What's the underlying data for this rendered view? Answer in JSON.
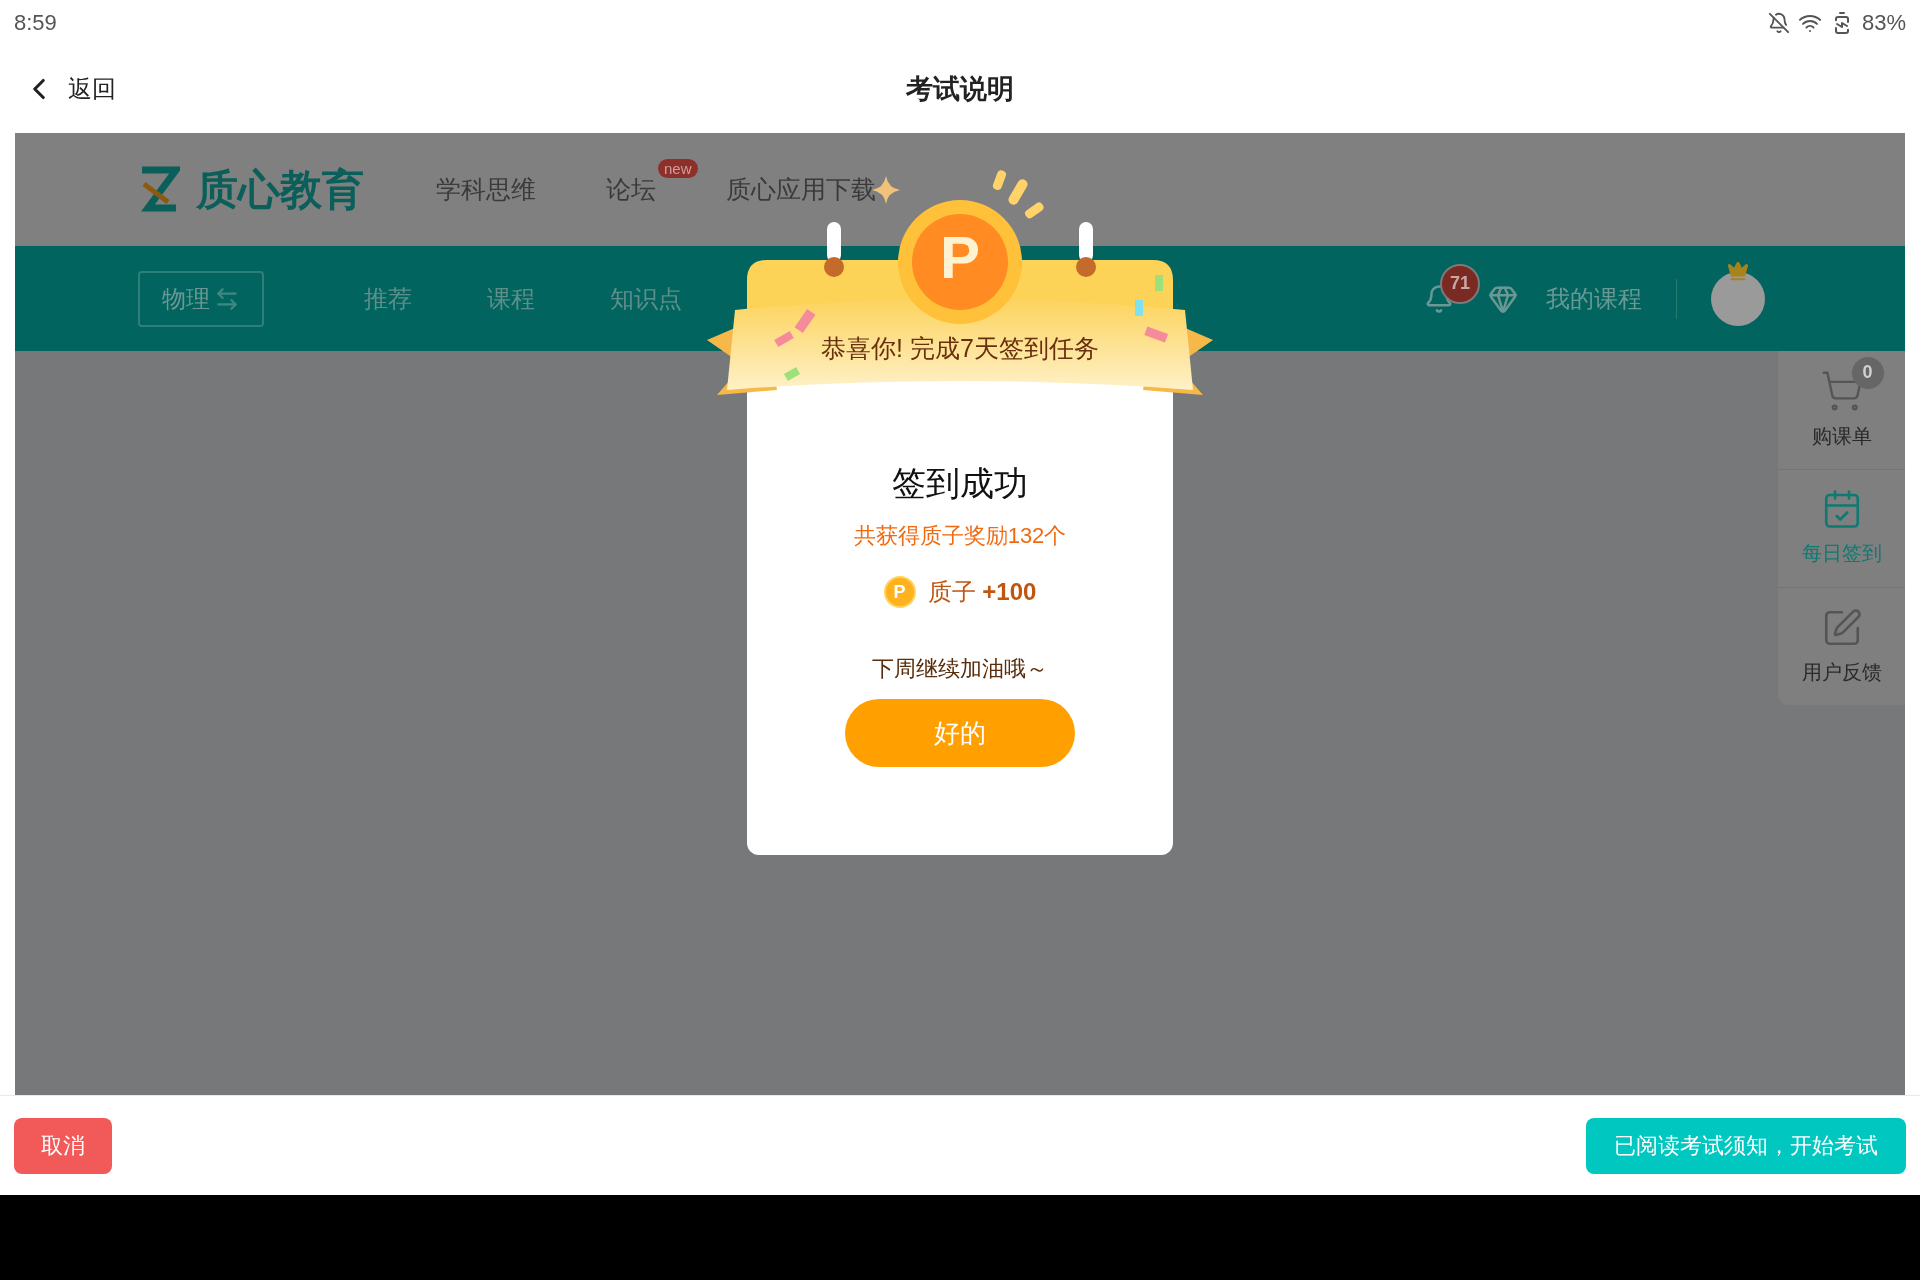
{
  "status_bar": {
    "time": "8:59",
    "battery": "83%"
  },
  "nav": {
    "back": "返回",
    "title": "考试说明"
  },
  "site": {
    "logo": "质心教育",
    "top_links": [
      {
        "label": "学科思维"
      },
      {
        "label": "论坛",
        "badge": "new"
      },
      {
        "label": "质心应用下载"
      }
    ],
    "subject": "物理",
    "menu": [
      "推荐",
      "课程",
      "知识点"
    ],
    "notification_count": "71",
    "my_courses": "我的课程",
    "side_panel": [
      {
        "label": "购课单",
        "kind": "cart",
        "count": "0",
        "selected": false
      },
      {
        "label": "每日签到",
        "kind": "checkin",
        "selected": true
      },
      {
        "label": "用户反馈",
        "kind": "feedback",
        "selected": false
      }
    ]
  },
  "dialog": {
    "coin_label": "P",
    "banner": "恭喜你! 完成7天签到任务",
    "title": "签到成功",
    "reward_total": "共获得质子奖励132个",
    "reward_coin_label": "P",
    "reward_line": "质子 **+100**",
    "message": "下周继续加油哦～",
    "ok_button": "好的"
  },
  "footer": {
    "cancel": "取消",
    "confirm": "已阅读考试须知，开始考试"
  }
}
